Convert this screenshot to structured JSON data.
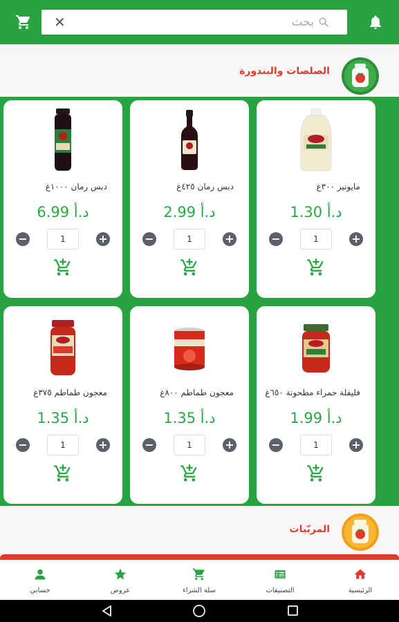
{
  "colors": {
    "brand_green": "#27a342",
    "accent_red": "#e03a2e",
    "price_green": "#2aa845"
  },
  "search": {
    "placeholder": "بحث",
    "clear_icon": "close-icon",
    "search_icon": "search-icon"
  },
  "header_icons": {
    "cart": "cart-icon",
    "notifications": "bell-icon"
  },
  "categories": [
    {
      "title": "الصلصات والبندورة",
      "icon": "tomato-jar-icon"
    },
    {
      "title": "المربّيات",
      "icon": "jam-jar-icon"
    }
  ],
  "products": [
    {
      "name": "مايونيز ٣٠٠غ",
      "price": "1.30 د.أ",
      "qty": "1",
      "image": "mayonnaise-bottle"
    },
    {
      "name": "دبس رمان ٤٢٥غ",
      "price": "2.99 د.أ",
      "qty": "1",
      "image": "pomegranate-molasses-bottle"
    },
    {
      "name": "دبس رمان ١٠٠٠غ",
      "price": "6.99 د.أ",
      "qty": "1",
      "image": "pomegranate-molasses-large-bottle"
    },
    {
      "name": "فليفلة حمراء مطحونة ٦٥٠غ",
      "price": "1.99 د.أ",
      "qty": "1",
      "image": "red-pepper-paste-jar"
    },
    {
      "name": "معجون طماطم ٨٠٠غ",
      "price": "1.35 د.أ",
      "qty": "1",
      "image": "tomato-paste-can"
    },
    {
      "name": "معجون طماطم ٣٧٥غ",
      "price": "1.35 د.أ",
      "qty": "1",
      "image": "tomato-paste-jar"
    }
  ],
  "bottom_nav": [
    {
      "label": "الرئيسية",
      "icon": "home-icon"
    },
    {
      "label": "التصنيفات",
      "icon": "categories-icon"
    },
    {
      "label": "سلة الشراء",
      "icon": "cart-icon"
    },
    {
      "label": "عروض",
      "icon": "star-icon"
    },
    {
      "label": "حسابي",
      "icon": "account-icon"
    }
  ]
}
